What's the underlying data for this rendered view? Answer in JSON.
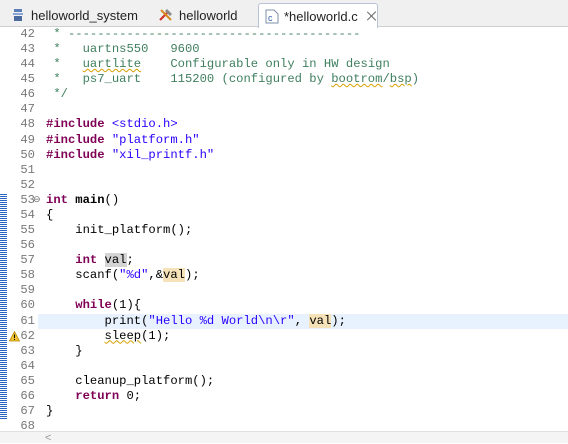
{
  "tabs": [
    {
      "label": "helloworld_system",
      "icon": "system-project-icon"
    },
    {
      "label": "helloworld",
      "icon": "application-project-icon"
    },
    {
      "label": "*helloworld.c",
      "icon": "c-file-icon",
      "active": true
    }
  ],
  "editor": {
    "lines": [
      {
        "num": "42",
        "html": "<span class=\"cm\"> * ----------------------------------------</span>"
      },
      {
        "num": "43",
        "html": "<span class=\"cm\"> *   uartns550   9600</span>"
      },
      {
        "num": "44",
        "html": "<span class=\"cm\"> *   <span class=\"squig\">uartlite</span>    Configurable only in HW design</span>"
      },
      {
        "num": "45",
        "html": "<span class=\"cm\"> *   ps7_uart    115200 (configured by <span class=\"squig\">bootrom</span>/<span class=\"squig\">bsp</span>)</span>"
      },
      {
        "num": "46",
        "html": "<span class=\"cm\"> */</span>"
      },
      {
        "num": "47",
        "html": ""
      },
      {
        "num": "48",
        "html": "<span class=\"kw\">#include</span> <span class=\"str\">&lt;stdio.h&gt;</span>"
      },
      {
        "num": "49",
        "html": "<span class=\"kw\">#include</span> <span class=\"str\">\"platform.h\"</span>"
      },
      {
        "num": "50",
        "html": "<span class=\"kw\">#include</span> <span class=\"str\">\"xil_printf.h\"</span>"
      },
      {
        "num": "51",
        "html": ""
      },
      {
        "num": "52",
        "html": ""
      },
      {
        "num": "53",
        "html": "<span class=\"kw\">int</span> <b>main</b>()",
        "fold": true
      },
      {
        "num": "54",
        "html": "{"
      },
      {
        "num": "55",
        "html": "    init_platform();"
      },
      {
        "num": "56",
        "html": ""
      },
      {
        "num": "57",
        "html": "    <span class=\"kw\">int</span> <span class=\"occ2\">val</span>;"
      },
      {
        "num": "58",
        "html": "    scanf(<span class=\"str\">\"%d\"</span>,&amp;<span class=\"occ\">val</span>);"
      },
      {
        "num": "59",
        "html": ""
      },
      {
        "num": "60",
        "html": "    <span class=\"kw\">while</span>(1){"
      },
      {
        "num": "61",
        "html": "        print(<span class=\"str\">\"Hello %d World\\n\\r\"</span>, <span class=\"occ\">val</span>);",
        "current": true
      },
      {
        "num": "62",
        "html": "        <span class=\"squig\">sleep</span>(1);",
        "warning": true
      },
      {
        "num": "63",
        "html": "    }"
      },
      {
        "num": "64",
        "html": ""
      },
      {
        "num": "65",
        "html": "    cleanup_platform();"
      },
      {
        "num": "66",
        "html": "    <span class=\"kw\">return</span> 0;"
      },
      {
        "num": "67",
        "html": "}"
      },
      {
        "num": "68",
        "html": ""
      }
    ]
  },
  "colors": {
    "change_bar": "#2b67c2",
    "current_line": "#e8f2fe"
  }
}
